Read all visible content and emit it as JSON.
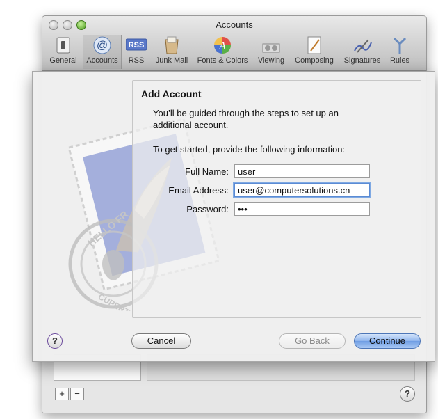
{
  "window": {
    "title": "Accounts"
  },
  "toolbar": {
    "items": [
      {
        "label": "General",
        "icon": "general-switch-icon"
      },
      {
        "label": "Accounts",
        "icon": "at-sign-icon"
      },
      {
        "label": "RSS",
        "icon": "rss-icon"
      },
      {
        "label": "Junk Mail",
        "icon": "junk-mail-icon"
      },
      {
        "label": "Fonts & Colors",
        "icon": "fonts-colors-icon"
      },
      {
        "label": "Viewing",
        "icon": "viewing-icon"
      },
      {
        "label": "Composing",
        "icon": "composing-icon"
      },
      {
        "label": "Signatures",
        "icon": "signatures-icon"
      },
      {
        "label": "Rules",
        "icon": "rules-icon"
      }
    ],
    "selected": "Accounts"
  },
  "sheet": {
    "title": "Add Account",
    "intro": "You’ll be guided through the steps to set up an additional account.",
    "prompt": "To get started, provide the following information:",
    "full_name_label": "Full Name:",
    "full_name_value": "user",
    "email_label": "Email Address:",
    "email_value": "user@computersolutions.cn",
    "password_label": "Password:",
    "password_value": "•••",
    "cancel_label": "Cancel",
    "goback_label": "Go Back",
    "continue_label": "Continue",
    "help_label": "?"
  },
  "bottom": {
    "add_label": "+",
    "remove_label": "−",
    "help_label": "?"
  },
  "colors": {
    "accent": "#6e9de3",
    "focus_ring": "#7fa9e3"
  }
}
